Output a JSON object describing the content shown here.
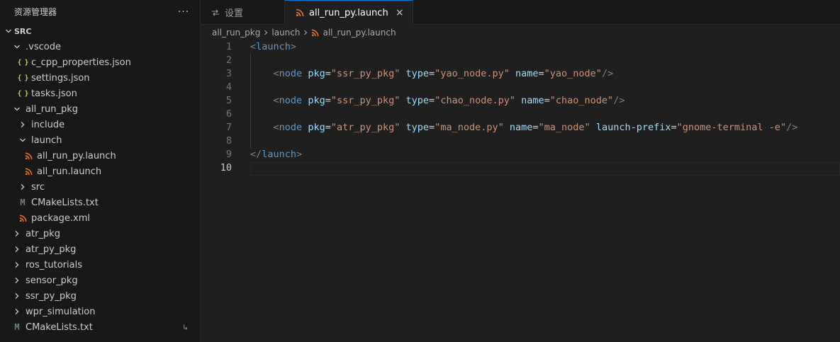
{
  "sidebar": {
    "title": "资源管理器",
    "more": "···",
    "root": "SRC",
    "items": [
      {
        "label": ".vscode",
        "kind": "folder",
        "open": true,
        "depth": 1
      },
      {
        "label": "c_cpp_properties.json",
        "kind": "json",
        "depth": 2
      },
      {
        "label": "settings.json",
        "kind": "json",
        "depth": 2
      },
      {
        "label": "tasks.json",
        "kind": "json",
        "depth": 2
      },
      {
        "label": "all_run_pkg",
        "kind": "folder",
        "open": true,
        "depth": 1
      },
      {
        "label": "include",
        "kind": "folder",
        "open": false,
        "depth": 2
      },
      {
        "label": "launch",
        "kind": "folder",
        "open": true,
        "depth": 2
      },
      {
        "label": "all_run_py.launch",
        "kind": "launch",
        "depth": 3
      },
      {
        "label": "all_run.launch",
        "kind": "launch",
        "depth": 3
      },
      {
        "label": "src",
        "kind": "folder",
        "open": false,
        "depth": 2
      },
      {
        "label": "CMakeLists.txt",
        "kind": "cmake",
        "depth": 2
      },
      {
        "label": "package.xml",
        "kind": "launch",
        "depth": 2
      },
      {
        "label": "atr_pkg",
        "kind": "folder",
        "open": false,
        "depth": 1
      },
      {
        "label": "atr_py_pkg",
        "kind": "folder",
        "open": false,
        "depth": 1
      },
      {
        "label": "ros_tutorials",
        "kind": "folder",
        "open": false,
        "depth": 1
      },
      {
        "label": "sensor_pkg",
        "kind": "folder",
        "open": false,
        "depth": 1
      },
      {
        "label": "ssr_py_pkg",
        "kind": "folder",
        "open": false,
        "depth": 1
      },
      {
        "label": "wpr_simulation",
        "kind": "folder",
        "open": false,
        "depth": 1
      },
      {
        "label": "CMakeLists.txt",
        "kind": "cmake",
        "depth": 1,
        "badge": "↳"
      }
    ]
  },
  "tabs": {
    "settings_label": "设置",
    "active_label": "all_run_py.launch",
    "close": "×"
  },
  "breadcrumb": {
    "parts": [
      "all_run_pkg",
      "launch",
      "all_run_py.launch"
    ]
  },
  "editor": {
    "active_line": 10,
    "lines": [
      [
        [
          "punc",
          "<"
        ],
        [
          "tag",
          "launch"
        ],
        [
          "punc",
          ">"
        ]
      ],
      [],
      [
        [
          "sp",
          "    "
        ],
        [
          "punc",
          "<"
        ],
        [
          "tag",
          "node"
        ],
        [
          "sp",
          " "
        ],
        [
          "attr",
          "pkg"
        ],
        [
          "eq",
          "="
        ],
        [
          "str",
          "\"ssr_py_pkg\""
        ],
        [
          "sp",
          " "
        ],
        [
          "attr",
          "type"
        ],
        [
          "eq",
          "="
        ],
        [
          "str",
          "\"yao_node.py\""
        ],
        [
          "sp",
          " "
        ],
        [
          "attr",
          "name"
        ],
        [
          "eq",
          "="
        ],
        [
          "str",
          "\"yao_node\""
        ],
        [
          "punc",
          "/>"
        ]
      ],
      [],
      [
        [
          "sp",
          "    "
        ],
        [
          "punc",
          "<"
        ],
        [
          "tag",
          "node"
        ],
        [
          "sp",
          " "
        ],
        [
          "attr",
          "pkg"
        ],
        [
          "eq",
          "="
        ],
        [
          "str",
          "\"ssr_py_pkg\""
        ],
        [
          "sp",
          " "
        ],
        [
          "attr",
          "type"
        ],
        [
          "eq",
          "="
        ],
        [
          "str",
          "\"chao_node.py\""
        ],
        [
          "sp",
          " "
        ],
        [
          "attr",
          "name"
        ],
        [
          "eq",
          "="
        ],
        [
          "str",
          "\"chao_node\""
        ],
        [
          "punc",
          "/>"
        ]
      ],
      [],
      [
        [
          "sp",
          "    "
        ],
        [
          "punc",
          "<"
        ],
        [
          "tag",
          "node"
        ],
        [
          "sp",
          " "
        ],
        [
          "attr",
          "pkg"
        ],
        [
          "eq",
          "="
        ],
        [
          "str",
          "\"atr_py_pkg\""
        ],
        [
          "sp",
          " "
        ],
        [
          "attr",
          "type"
        ],
        [
          "eq",
          "="
        ],
        [
          "str",
          "\"ma_node.py\""
        ],
        [
          "sp",
          " "
        ],
        [
          "attr",
          "name"
        ],
        [
          "eq",
          "="
        ],
        [
          "str",
          "\"ma_node\""
        ],
        [
          "sp",
          " "
        ],
        [
          "attr",
          "launch-prefix"
        ],
        [
          "eq",
          "="
        ],
        [
          "str",
          "\"gnome-terminal -e\""
        ],
        [
          "punc",
          "/>"
        ]
      ],
      [],
      [
        [
          "punc",
          "</"
        ],
        [
          "tag",
          "launch"
        ],
        [
          "punc",
          ">"
        ]
      ],
      []
    ]
  },
  "colors": {
    "accent": "#0078d4",
    "tag": "#569cd6",
    "attr": "#9cdcfe",
    "string": "#ce9178",
    "json_icon": "#cbcb41",
    "launch_icon": "#e37933"
  }
}
